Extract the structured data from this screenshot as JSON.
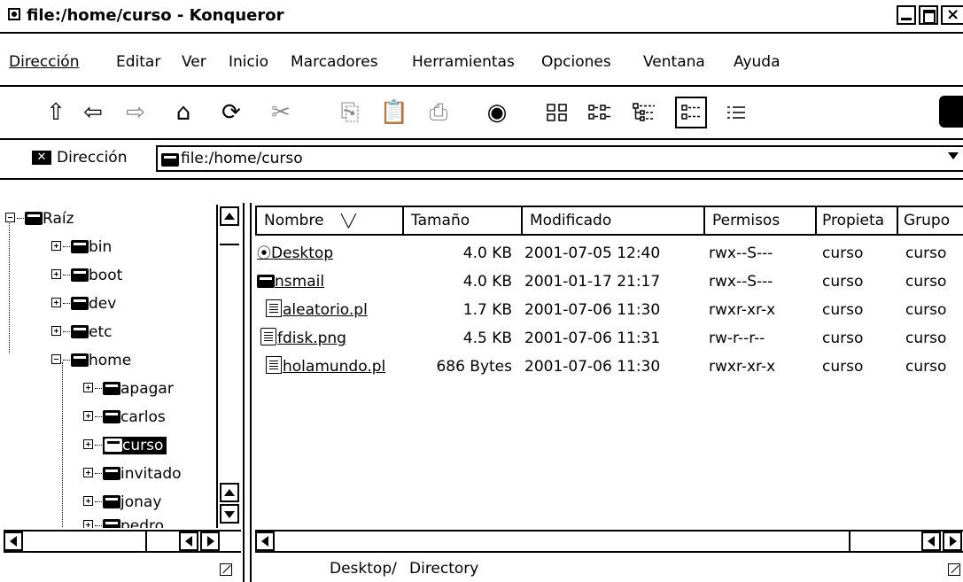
{
  "window": {
    "title": "file:/home/curso - Konqueror",
    "close_glyph": "×"
  },
  "menu": [
    {
      "label": "Dirección"
    },
    {
      "label": "Editar"
    },
    {
      "label": "Ver"
    },
    {
      "label": "Inicio"
    },
    {
      "label": "Marcadores"
    },
    {
      "label": "Herramientas"
    },
    {
      "label": "Opciones"
    },
    {
      "label": "Ventana"
    },
    {
      "label": "Ayuda"
    }
  ],
  "toolbar": {
    "buttons": [
      {
        "icon": "up-arrow-icon",
        "glyph": "⇧"
      },
      {
        "icon": "back-arrow-icon",
        "glyph": "⇦"
      },
      {
        "icon": "forward-arrow-icon",
        "glyph": "⇨"
      },
      {
        "icon": "home-icon",
        "glyph": "⌂"
      },
      {
        "icon": "reload-icon",
        "glyph": "⟳"
      },
      {
        "icon": "cut-icon",
        "glyph": "✂"
      },
      {
        "icon": "copy-icon",
        "glyph": "⎘"
      },
      {
        "icon": "paste-icon",
        "glyph": "📋"
      },
      {
        "icon": "print-icon",
        "glyph": "⎙"
      },
      {
        "icon": "stop-icon",
        "glyph": "◉"
      }
    ]
  },
  "location": {
    "label": "Dirección",
    "value": "file:/home/curso"
  },
  "tree": {
    "items": [
      {
        "label": "Raíz",
        "level": 0,
        "expanded": true
      },
      {
        "label": "bin",
        "level": 1
      },
      {
        "label": "boot",
        "level": 1
      },
      {
        "label": "dev",
        "level": 1
      },
      {
        "label": "etc",
        "level": 1
      },
      {
        "label": "home",
        "level": 1,
        "expanded": true
      },
      {
        "label": "apagar",
        "level": 2
      },
      {
        "label": "carlos",
        "level": 2
      },
      {
        "label": "curso",
        "level": 2,
        "selected": true
      },
      {
        "label": "invitado",
        "level": 2
      },
      {
        "label": "jonay",
        "level": 2
      },
      {
        "label": "pedro",
        "level": 2
      }
    ]
  },
  "list": {
    "columns": [
      "Nombre",
      "Tamaño",
      "Modificado",
      "Permisos",
      "Propieta",
      "Grupo"
    ],
    "sort_glyph": "╲╱",
    "rows": [
      {
        "name": "Desktop",
        "size": "4.0 KB",
        "modified": "2001-07-05 12:40",
        "perms": "rwx--S---",
        "owner": "curso",
        "group": "curso",
        "icon": "desktop-icon"
      },
      {
        "name": "nsmail",
        "size": "4.0 KB",
        "modified": "2001-01-17 21:17",
        "perms": "rwx--S---",
        "owner": "curso",
        "group": "curso",
        "icon": "folder-icon"
      },
      {
        "name": "aleatorio.pl",
        "size": "1.7 KB",
        "modified": "2001-07-06 11:30",
        "perms": "rwxr-xr-x",
        "owner": "curso",
        "group": "curso",
        "icon": "text-file-icon"
      },
      {
        "name": "fdisk.png",
        "size": "4.5 KB",
        "modified": "2001-07-06 11:31",
        "perms": "rw-r--r--",
        "owner": "curso",
        "group": "curso",
        "icon": "image-file-icon"
      },
      {
        "name": "holamundo.pl",
        "size": "686 Bytes",
        "modified": "2001-07-06 11:30",
        "perms": "rwxr-xr-x",
        "owner": "curso",
        "group": "curso",
        "icon": "text-file-icon"
      }
    ]
  },
  "status": {
    "item": "Desktop/",
    "type": "Directory"
  }
}
